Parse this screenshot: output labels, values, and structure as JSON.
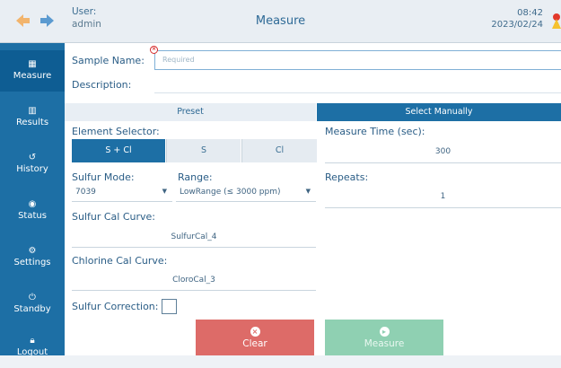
{
  "header": {
    "user_label": "User:",
    "user_name": "admin",
    "title": "Measure",
    "time": "08:42",
    "date": "2023/02/24",
    "back_icon": "arrow-left-icon",
    "forward_icon": "arrow-right-icon",
    "alert_icon": "warning-icon"
  },
  "sidebar": {
    "items": [
      {
        "label": "Measure",
        "icon": "measure-icon",
        "active": true
      },
      {
        "label": "Results",
        "icon": "results-icon"
      },
      {
        "label": "History",
        "icon": "history-icon"
      },
      {
        "label": "Status",
        "icon": "status-icon"
      },
      {
        "label": "Settings",
        "icon": "settings-icon"
      },
      {
        "label": "Standby",
        "icon": "standby-icon"
      },
      {
        "label": "Logout",
        "icon": "logout-icon"
      }
    ]
  },
  "form": {
    "sample_name_label": "Sample Name:",
    "sample_name_placeholder": "Required",
    "description_label": "Description:"
  },
  "tabs": {
    "preset": "Preset",
    "manual": "Select Manually"
  },
  "element_selector": {
    "label": "Element Selector:",
    "options": [
      "S + Cl",
      "S",
      "Cl"
    ],
    "selected": "S + Cl"
  },
  "sulfur_mode": {
    "label": "Sulfur Mode:",
    "value": "7039"
  },
  "range": {
    "label": "Range:",
    "value": "LowRange (≤ 3000 ppm)"
  },
  "sulfur_cal": {
    "label": "Sulfur Cal Curve:",
    "value": "SulfurCal_4"
  },
  "chlorine_cal": {
    "label": "Chlorine Cal Curve:",
    "value": "CloroCal_3"
  },
  "sulfur_correction": {
    "label": "Sulfur Correction:"
  },
  "measure_time": {
    "label": "Measure Time (sec):",
    "value": "300"
  },
  "repeats": {
    "label": "Repeats:",
    "value": "1"
  },
  "buttons": {
    "clear": "Clear",
    "measure": "Measure"
  },
  "colors": {
    "accent": "#1d6fa5",
    "clear": "#dd6b68",
    "measure": "#8fd0b2"
  }
}
